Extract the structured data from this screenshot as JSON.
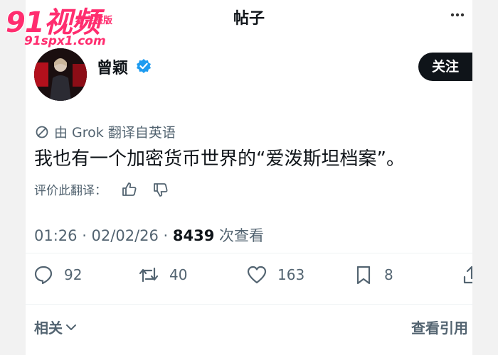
{
  "watermark": {
    "brand": "91视频",
    "tagline": "看完整版",
    "url": "91spx1.com"
  },
  "header": {
    "title": "帖子",
    "menu_icon": "more-icon"
  },
  "author": {
    "name": "曾颖",
    "verified": true,
    "follow_label": "关注"
  },
  "post": {
    "translation_note": "由 Grok 翻译自英语",
    "text": "我也有一个加密货币世界的“爱泼斯坦档案”。",
    "rate_label": "评价此翻译："
  },
  "meta": {
    "time": "01:26 · 02/02/26 · ",
    "views": "8439",
    "views_label": " 次查看"
  },
  "actions": {
    "replies": "92",
    "reposts": "40",
    "likes": "163",
    "bookmarks": "8"
  },
  "footer": {
    "related_label": "相关",
    "quotes_label": "查看引用"
  },
  "colors": {
    "accent": "#1d9bf0",
    "text_primary": "#0f1419",
    "text_secondary": "#536471",
    "watermark": "#ff2d6f"
  }
}
